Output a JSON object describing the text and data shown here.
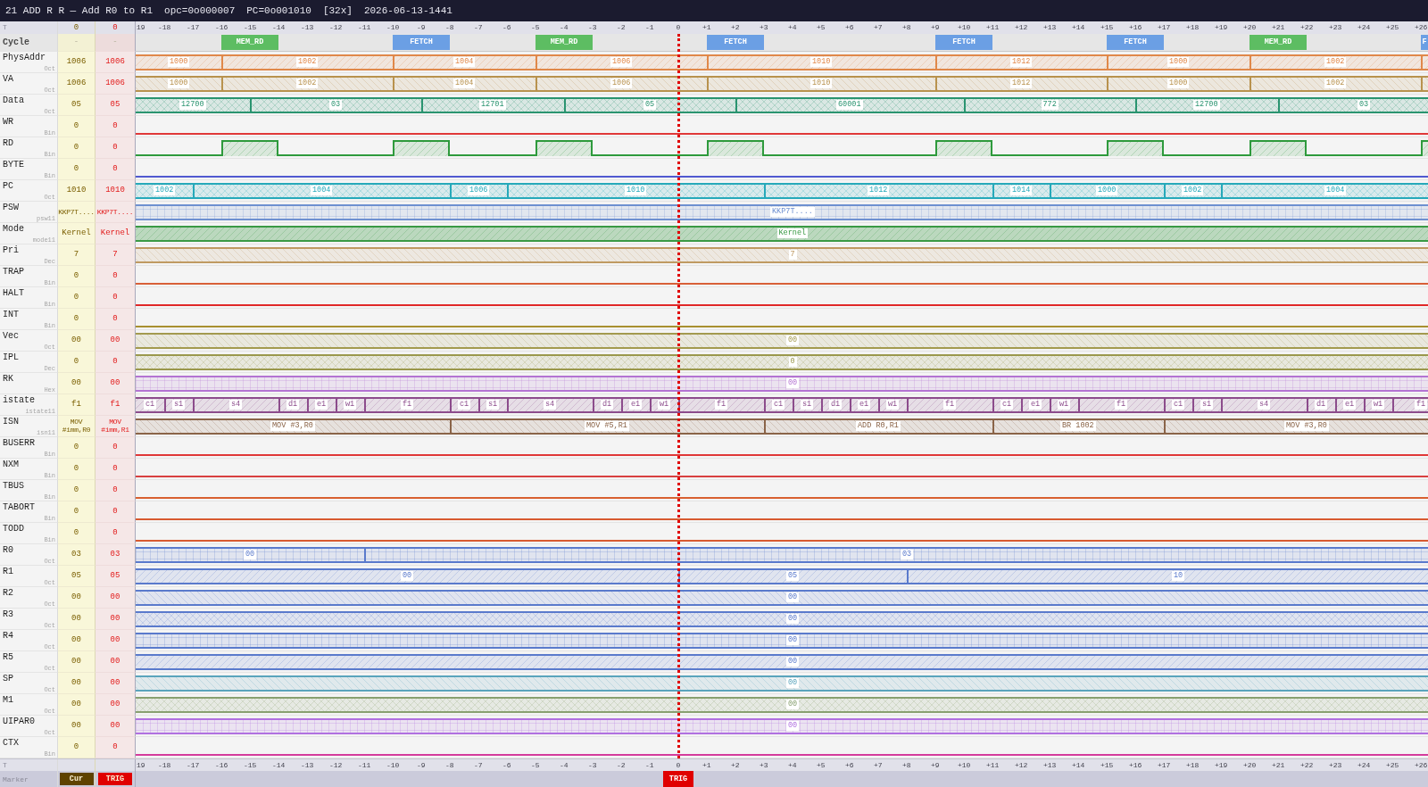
{
  "title_bar": {
    "title": "21 ADD R R — Add R0 to R1",
    "opcode": "opc=0o000007",
    "pc": "PC=0o001010",
    "zoom": "[32x]",
    "timestamp": "2026-06-13-1441"
  },
  "time_header": {
    "label": "T",
    "cursor_time": "0",
    "trigger_time": "0",
    "ticks": [
      "19",
      "-18",
      "-17",
      "-16",
      "-15",
      "-14",
      "-13",
      "-12",
      "-11",
      "-10",
      "-9",
      "-8",
      "-7",
      "-6",
      "-5",
      "-4",
      "-3",
      "-2",
      "-1",
      "0",
      "+1",
      "+2",
      "+3",
      "+4",
      "+5",
      "+6",
      "+7",
      "+8",
      "+9",
      "+10",
      "+11",
      "+12",
      "+13",
      "+14",
      "+15",
      "+16",
      "+17",
      "+18",
      "+19",
      "+20",
      "+21",
      "+22",
      "+23",
      "+24",
      "+25",
      "+26"
    ]
  },
  "signals": [
    {
      "name": "Cycle",
      "kind": "phases",
      "cursor_value": "-",
      "trigger_value": "-",
      "blocks": [
        {
          "label": "MEM_RD",
          "color": "#5dbd62"
        },
        {
          "label": "FETCH",
          "color": "#6b9fe4"
        },
        {
          "label": "MEM_RD",
          "color": "#5dbd62"
        },
        {
          "label": "FETCH",
          "color": "#6b9fe4"
        },
        {
          "label": "FETCH",
          "color": "#6b9fe4"
        },
        {
          "label": "FETCH",
          "color": "#6b9fe4"
        },
        {
          "label": "MEM_RD",
          "color": "#5dbd62"
        },
        {
          "label": "F",
          "color": "#6b9fe4"
        }
      ]
    },
    {
      "name": "PhysAddr",
      "format": "Oct",
      "kind": "bus",
      "color": "#e0884a",
      "cursor_value": "1006",
      "trigger_value": "1006",
      "segments": [
        {
          "label": "1000"
        },
        {
          "label": "1002"
        },
        {
          "label": "1004"
        },
        {
          "label": "1006"
        },
        {
          "label": "1010"
        },
        {
          "label": "1012"
        },
        {
          "label": "1000"
        },
        {
          "label": "1002"
        }
      ]
    },
    {
      "name": "VA",
      "format": "Oct",
      "kind": "bus",
      "color": "#b8924e",
      "cursor_value": "1006",
      "trigger_value": "1006",
      "segments": [
        {
          "label": "1000"
        },
        {
          "label": "1002"
        },
        {
          "label": "1004"
        },
        {
          "label": "1006"
        },
        {
          "label": "1010"
        },
        {
          "label": "1012"
        },
        {
          "label": "1000"
        },
        {
          "label": "1002"
        }
      ]
    },
    {
      "name": "Data",
      "format": "Oct",
      "kind": "bus",
      "color": "#2a9470",
      "cursor_value": "05",
      "trigger_value": "05",
      "segments": [
        {
          "label": "12700"
        },
        {
          "label": "03"
        },
        {
          "label": "12701"
        },
        {
          "label": "05"
        },
        {
          "label": "60001"
        },
        {
          "label": "772"
        },
        {
          "label": "12700"
        },
        {
          "label": "03"
        }
      ]
    },
    {
      "name": "WR",
      "format": "Bin",
      "kind": "bit",
      "color": "#e03838",
      "cursor_value": "0",
      "trigger_value": "0",
      "segments": [
        {
          "high": false
        }
      ]
    },
    {
      "name": "RD",
      "format": "Bin",
      "kind": "bit",
      "color": "#2e9a3c",
      "cursor_value": "0",
      "trigger_value": "0",
      "segments": [
        {
          "high": false
        },
        {
          "high": true
        },
        {
          "high": false
        },
        {
          "high": true
        },
        {
          "high": false
        },
        {
          "high": true
        },
        {
          "high": false
        },
        {
          "high": true
        },
        {
          "high": false
        },
        {
          "high": true
        },
        {
          "high": false
        },
        {
          "high": true
        },
        {
          "high": false
        },
        {
          "high": true
        },
        {
          "high": false
        },
        {
          "high": true
        }
      ]
    },
    {
      "name": "BYTE",
      "format": "Bin",
      "kind": "bit",
      "color": "#5058d0",
      "cursor_value": "0",
      "trigger_value": "0",
      "segments": [
        {
          "high": false
        }
      ]
    },
    {
      "name": "PC",
      "format": "Oct",
      "kind": "bus",
      "color": "#26a9ba",
      "cursor_value": "1010",
      "trigger_value": "1010",
      "segments": [
        {
          "label": "1002"
        },
        {
          "label": "1004"
        },
        {
          "label": "1006"
        },
        {
          "label": "1010"
        },
        {
          "label": "1012"
        },
        {
          "label": "1014"
        },
        {
          "label": "1000"
        },
        {
          "label": "1002"
        },
        {
          "label": "1004"
        }
      ]
    },
    {
      "name": "PSW",
      "format": "psw11",
      "kind": "bus",
      "color": "#6e90d0",
      "cursor_value": "KKP7T....",
      "trigger_value": "KKP7T....",
      "segments": [
        {
          "label": "KKP7T...."
        }
      ]
    },
    {
      "name": "Mode",
      "format": "mode11",
      "kind": "bus",
      "color": "#3a9a44",
      "cursor_value": "Kernel",
      "trigger_value": "Kernel",
      "segments": [
        {
          "label": "Kernel"
        }
      ]
    },
    {
      "name": "Pri",
      "format": "Dec",
      "kind": "bus",
      "color": "#bf9a62",
      "cursor_value": "7",
      "trigger_value": "7",
      "segments": [
        {
          "label": "7"
        }
      ]
    },
    {
      "name": "TRAP",
      "format": "Bin",
      "kind": "bit",
      "color": "#d86038",
      "cursor_value": "0",
      "trigger_value": "0",
      "segments": [
        {
          "high": false
        }
      ]
    },
    {
      "name": "HALT",
      "format": "Bin",
      "kind": "bit",
      "color": "#e02828",
      "cursor_value": "0",
      "trigger_value": "0",
      "segments": [
        {
          "high": false
        }
      ]
    },
    {
      "name": "INT",
      "format": "Bin",
      "kind": "bit",
      "color": "#a89030",
      "cursor_value": "0",
      "trigger_value": "0",
      "segments": [
        {
          "high": false
        }
      ]
    },
    {
      "name": "Vec",
      "format": "Oct",
      "kind": "bus",
      "color": "#a39a4e",
      "cursor_value": "00",
      "trigger_value": "00",
      "segments": [
        {
          "label": "00"
        }
      ]
    },
    {
      "name": "IPL",
      "format": "Dec",
      "kind": "bus",
      "color": "#9a984c",
      "cursor_value": "0",
      "trigger_value": "0",
      "segments": [
        {
          "label": "0"
        }
      ]
    },
    {
      "name": "RK",
      "format": "Hex",
      "kind": "bus",
      "color": "#b474d2",
      "cursor_value": "00",
      "trigger_value": "00",
      "segments": [
        {
          "label": "00"
        }
      ]
    },
    {
      "name": "istate",
      "format": "istate11",
      "kind": "bus",
      "color": "#8c4c8c",
      "cursor_value": "f1",
      "trigger_value": "f1",
      "segments": [
        {
          "label": "c1"
        },
        {
          "label": "s1"
        },
        {
          "label": "s4"
        },
        {
          "label": "d1"
        },
        {
          "label": "e1"
        },
        {
          "label": "w1"
        },
        {
          "label": "f1"
        },
        {
          "label": "c1"
        },
        {
          "label": "s1"
        },
        {
          "label": "s4"
        },
        {
          "label": "d1"
        },
        {
          "label": "e1"
        },
        {
          "label": "w1"
        },
        {
          "label": "f1"
        },
        {
          "label": "c1"
        },
        {
          "label": "s1"
        },
        {
          "label": "d1"
        },
        {
          "label": "e1"
        },
        {
          "label": "w1"
        },
        {
          "label": "f1"
        },
        {
          "label": "c1"
        },
        {
          "label": "e1"
        },
        {
          "label": "w1"
        },
        {
          "label": "f1"
        },
        {
          "label": "c1"
        },
        {
          "label": "s1"
        },
        {
          "label": "s4"
        },
        {
          "label": "d1"
        },
        {
          "label": "e1"
        },
        {
          "label": "w1"
        },
        {
          "label": "f1"
        }
      ]
    },
    {
      "name": "ISN",
      "format": "isn11",
      "kind": "bus",
      "color": "#8a6448",
      "cursor_value": "MOV #imm,R0",
      "trigger_value": "MOV #imm,R1",
      "segments": [
        {
          "label": "MOV #3,R0"
        },
        {
          "label": "MOV #5,R1"
        },
        {
          "label": "ADD R0,R1"
        },
        {
          "label": "BR 1002"
        },
        {
          "label": "MOV #3,R0"
        }
      ]
    },
    {
      "name": "BUSERR",
      "format": "Bin",
      "kind": "bit",
      "color": "#e03838",
      "cursor_value": "0",
      "trigger_value": "0",
      "segments": [
        {
          "high": false
        }
      ]
    },
    {
      "name": "NXM",
      "format": "Bin",
      "kind": "bit",
      "color": "#d84040",
      "cursor_value": "0",
      "trigger_value": "0",
      "segments": [
        {
          "high": false
        }
      ]
    },
    {
      "name": "TBUS",
      "format": "Bin",
      "kind": "bit",
      "color": "#d86030",
      "cursor_value": "0",
      "trigger_value": "0",
      "segments": [
        {
          "high": false
        }
      ]
    },
    {
      "name": "TABORT",
      "format": "Bin",
      "kind": "bit",
      "color": "#d85a30",
      "cursor_value": "0",
      "trigger_value": "0",
      "segments": [
        {
          "high": false
        }
      ]
    },
    {
      "name": "TODD",
      "format": "Bin",
      "kind": "bit",
      "color": "#d85a30",
      "cursor_value": "0",
      "trigger_value": "0",
      "segments": [
        {
          "high": false
        }
      ]
    },
    {
      "name": "R0",
      "format": "Oct",
      "kind": "bus",
      "color": "#5a7acc",
      "cursor_value": "03",
      "trigger_value": "03",
      "segments": [
        {
          "label": "00"
        },
        {
          "label": "03"
        }
      ]
    },
    {
      "name": "R1",
      "format": "Oct",
      "kind": "bus",
      "color": "#5a7acc",
      "cursor_value": "05",
      "trigger_value": "05",
      "segments": [
        {
          "label": "00"
        },
        {
          "label": "05"
        },
        {
          "label": "10"
        }
      ]
    },
    {
      "name": "R2",
      "format": "Oct",
      "kind": "bus",
      "color": "#5a7acc",
      "cursor_value": "00",
      "trigger_value": "00",
      "segments": [
        {
          "label": "00"
        }
      ]
    },
    {
      "name": "R3",
      "format": "Oct",
      "kind": "bus",
      "color": "#5a7acc",
      "cursor_value": "00",
      "trigger_value": "00",
      "segments": [
        {
          "label": "00"
        }
      ]
    },
    {
      "name": "R4",
      "format": "Oct",
      "kind": "bus",
      "color": "#5a7acc",
      "cursor_value": "00",
      "trigger_value": "00",
      "segments": [
        {
          "label": "00"
        }
      ]
    },
    {
      "name": "R5",
      "format": "Oct",
      "kind": "bus",
      "color": "#5a7acc",
      "cursor_value": "00",
      "trigger_value": "00",
      "segments": [
        {
          "label": "00"
        }
      ]
    },
    {
      "name": "SP",
      "format": "Oct",
      "kind": "bus",
      "color": "#5aa4bc",
      "cursor_value": "00",
      "trigger_value": "00",
      "segments": [
        {
          "label": "00"
        }
      ]
    },
    {
      "name": "M1",
      "format": "Oct",
      "kind": "bus",
      "color": "#88a070",
      "cursor_value": "00",
      "trigger_value": "00",
      "segments": [
        {
          "label": "00"
        }
      ]
    },
    {
      "name": "UIPAR0",
      "format": "Oct",
      "kind": "bus",
      "color": "#b070e0",
      "cursor_value": "00",
      "trigger_value": "00",
      "segments": [
        {
          "label": "00"
        }
      ]
    },
    {
      "name": "CTX",
      "format": "Bin",
      "kind": "bit",
      "color": "#d43c9c",
      "cursor_value": "0",
      "trigger_value": "0",
      "segments": [
        {
          "high": false
        }
      ]
    }
  ],
  "trigger_marker": {
    "label": "TRIG",
    "color": "#e00000"
  },
  "time_footer": {
    "label": "T",
    "ticks": [
      "19",
      "-18",
      "-17",
      "-16",
      "-15",
      "-14",
      "-13",
      "-12",
      "-11",
      "-10",
      "-9",
      "-8",
      "-7",
      "-6",
      "-5",
      "-4",
      "-3",
      "-2",
      "-1",
      "0",
      "+1",
      "+2",
      "+3",
      "+4",
      "+5",
      "+6",
      "+7",
      "+8",
      "+9",
      "+10",
      "+11",
      "+12",
      "+13",
      "+14",
      "+15",
      "+16",
      "+17",
      "+18",
      "+19",
      "+20",
      "+21",
      "+22",
      "+23",
      "+24",
      "+25",
      "+26"
    ]
  },
  "marker_bar": {
    "label": "Marker",
    "buttons": [
      {
        "label": "Cur",
        "color": "#5e4200"
      },
      {
        "label": "TRIG",
        "color": "#e00000"
      }
    ]
  }
}
